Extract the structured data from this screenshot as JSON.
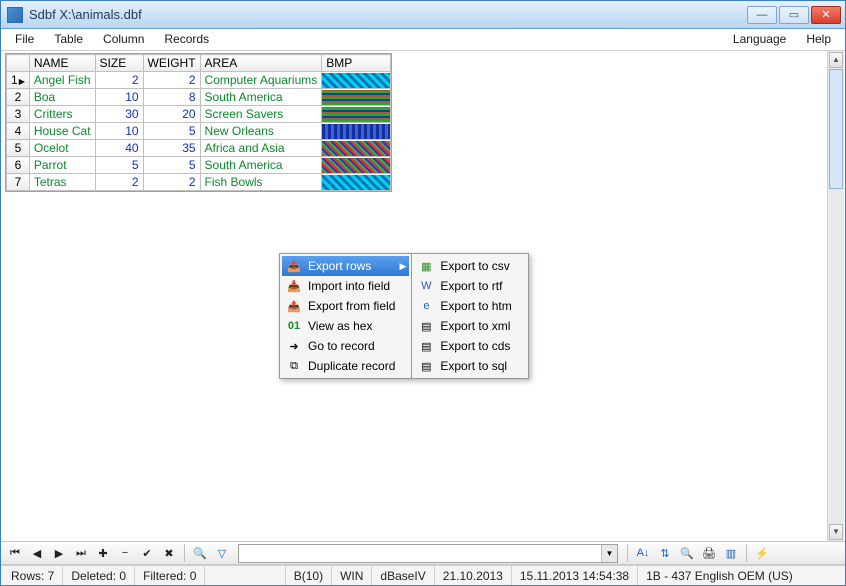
{
  "window": {
    "title": "Sdbf X:\\animals.dbf"
  },
  "menus": {
    "file": "File",
    "table": "Table",
    "column": "Column",
    "records": "Records",
    "language": "Language",
    "help": "Help"
  },
  "grid": {
    "headers": {
      "name": "NAME",
      "size": "SIZE",
      "weight": "WEIGHT",
      "area": "AREA",
      "bmp": "BMP"
    },
    "rows": [
      {
        "n": "1",
        "name": "Angel Fish",
        "size": "2",
        "weight": "2",
        "area": "Computer Aquariums"
      },
      {
        "n": "2",
        "name": "Boa",
        "size": "10",
        "weight": "8",
        "area": "South America"
      },
      {
        "n": "3",
        "name": "Critters",
        "size": "30",
        "weight": "20",
        "area": "Screen Savers"
      },
      {
        "n": "4",
        "name": "House Cat",
        "size": "10",
        "weight": "5",
        "area": "New Orleans"
      },
      {
        "n": "5",
        "name": "Ocelot",
        "size": "40",
        "weight": "35",
        "area": "Africa and Asia"
      },
      {
        "n": "6",
        "name": "Parrot",
        "size": "5",
        "weight": "5",
        "area": "South America"
      },
      {
        "n": "7",
        "name": "Tetras",
        "size": "2",
        "weight": "2",
        "area": "Fish Bowls"
      }
    ]
  },
  "context_menu": {
    "main": [
      {
        "label": "Export rows",
        "submenu": true,
        "selected": true
      },
      {
        "label": "Import into field"
      },
      {
        "label": "Export from field"
      },
      {
        "label": "View as hex"
      },
      {
        "label": "Go to record"
      },
      {
        "label": "Duplicate record"
      }
    ],
    "sub": [
      {
        "label": "Export to csv"
      },
      {
        "label": "Export to rtf"
      },
      {
        "label": "Export to htm"
      },
      {
        "label": "Export to xml"
      },
      {
        "label": "Export to cds"
      },
      {
        "label": "Export to sql"
      }
    ]
  },
  "status": {
    "rows": "Rows: 7",
    "deleted": "Deleted: 0",
    "filtered": "Filtered: 0",
    "field_type": "B(10)",
    "charset": "WIN",
    "format": "dBaseIV",
    "file_date": "21.10.2013",
    "now": "15.11.2013 14:54:38",
    "codepage": "1B - 437 English OEM (US)"
  }
}
